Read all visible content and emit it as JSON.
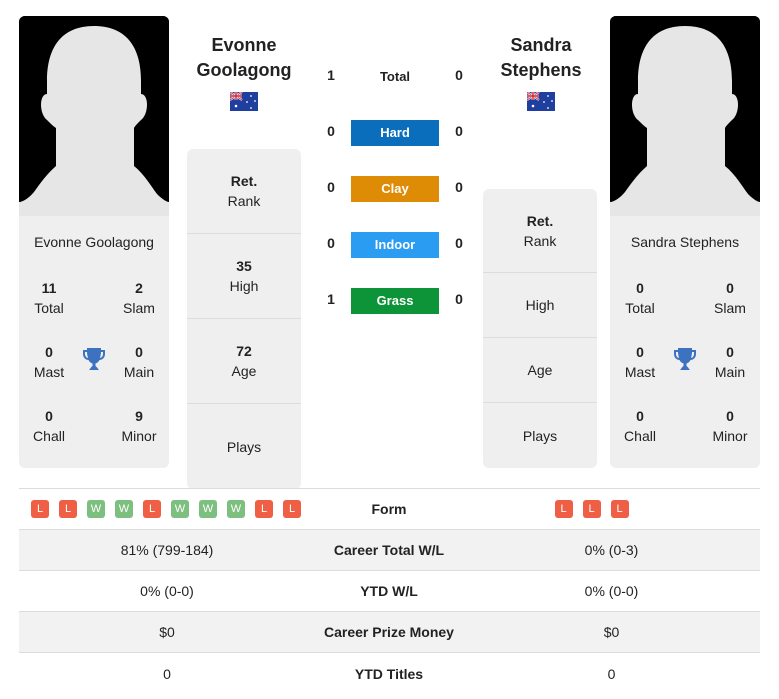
{
  "player1": {
    "name_line1": "Evonne",
    "name_line2": "Goolagong",
    "full_name": "Evonne Goolagong",
    "flag": "australia-flag",
    "titles": {
      "total": "11",
      "total_label": "Total",
      "slam": "2",
      "slam_label": "Slam",
      "mast": "0",
      "mast_label": "Mast",
      "main": "0",
      "main_label": "Main",
      "chall": "0",
      "chall_label": "Chall",
      "minor": "9",
      "minor_label": "Minor"
    },
    "info": {
      "rank_value": "Ret.",
      "rank_label": "Rank",
      "high_value": "35",
      "high_label": "High",
      "age_value": "72",
      "age_label": "Age",
      "plays_value": "",
      "plays_label": "Plays"
    },
    "form": [
      "L",
      "L",
      "W",
      "W",
      "L",
      "W",
      "W",
      "W",
      "L",
      "L"
    ]
  },
  "player2": {
    "name_line1": "Sandra",
    "name_line2": "Stephens",
    "full_name": "Sandra Stephens",
    "flag": "australia-flag",
    "titles": {
      "total": "0",
      "total_label": "Total",
      "slam": "0",
      "slam_label": "Slam",
      "mast": "0",
      "mast_label": "Mast",
      "main": "0",
      "main_label": "Main",
      "chall": "0",
      "chall_label": "Chall",
      "minor": "0",
      "minor_label": "Minor"
    },
    "info": {
      "rank_value": "Ret.",
      "rank_label": "Rank",
      "high_value": "",
      "high_label": "High",
      "age_value": "",
      "age_label": "Age",
      "plays_value": "",
      "plays_label": "Plays"
    },
    "form": [
      "L",
      "L",
      "L"
    ]
  },
  "h2h": {
    "total": {
      "label": "Total",
      "p1": "1",
      "p2": "0"
    },
    "surfaces": [
      {
        "label": "Hard",
        "p1": "0",
        "p2": "0",
        "color": "#0a6ebd"
      },
      {
        "label": "Clay",
        "p1": "0",
        "p2": "0",
        "color": "#de8c05"
      },
      {
        "label": "Indoor",
        "p1": "0",
        "p2": "0",
        "color": "#2a9cf2"
      },
      {
        "label": "Grass",
        "p1": "1",
        "p2": "0",
        "color": "#0d9439"
      }
    ]
  },
  "stats": {
    "form_label": "Form",
    "rows": [
      {
        "label": "Career Total W/L",
        "p1": "81% (799-184)",
        "p2": "0% (0-3)"
      },
      {
        "label": "YTD W/L",
        "p1": "0% (0-0)",
        "p2": "0% (0-0)"
      },
      {
        "label": "Career Prize Money",
        "p1": "$0",
        "p2": "$0"
      },
      {
        "label": "YTD Titles",
        "p1": "0",
        "p2": "0"
      }
    ]
  },
  "colors": {
    "win": "#7cbf7e",
    "loss": "#ef5f45",
    "trophy": "#3d72c0"
  }
}
